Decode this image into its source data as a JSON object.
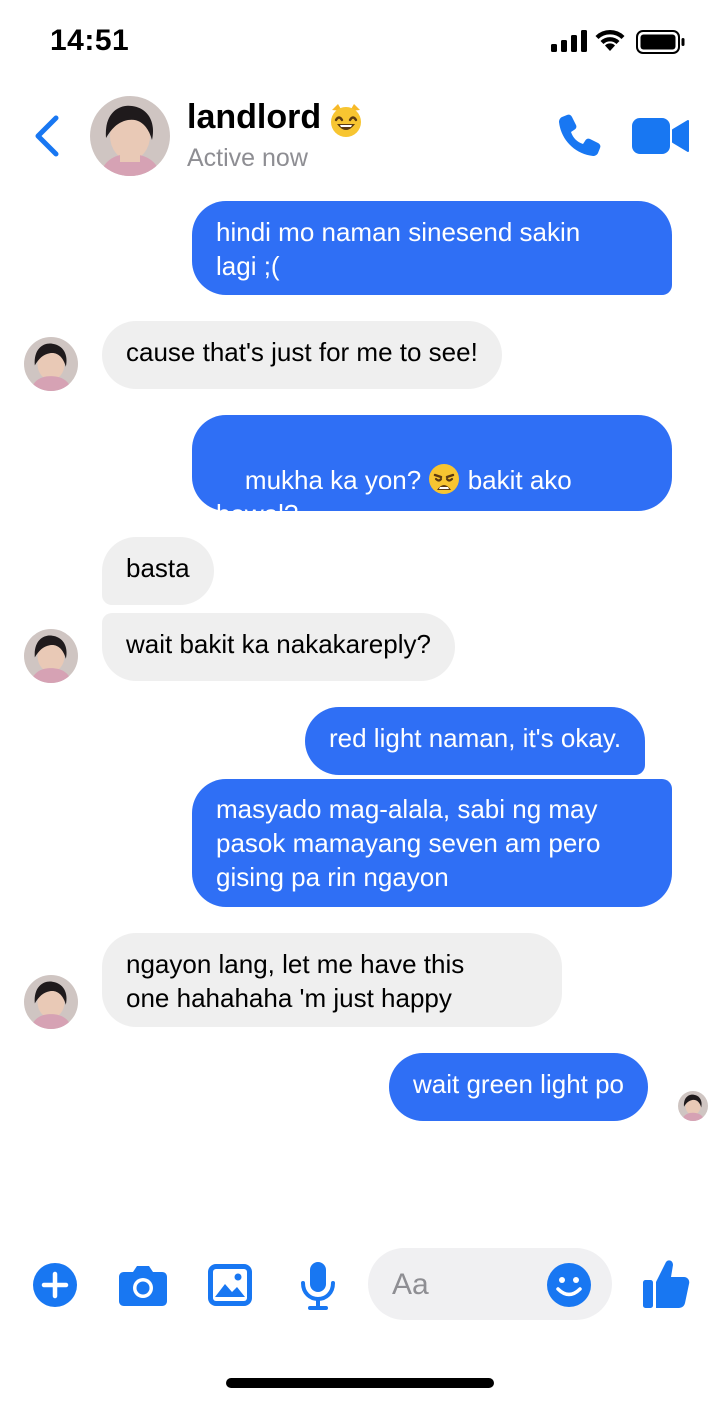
{
  "status_bar": {
    "time": "14:51"
  },
  "header": {
    "contact_name": "landlord",
    "contact_status": "Active now",
    "emoji_icon": "grinning-cat-emoji"
  },
  "messages": [
    {
      "from": "me",
      "text": "hindi mo naman sinesend sakin\nlagi ;("
    },
    {
      "from": "them",
      "text": "cause that's just for me to see!"
    },
    {
      "from": "me",
      "text_a": "mukha ka yon? ",
      "emoji": "weary-face",
      "text_b": " bakit ako\nbawal?"
    },
    {
      "from": "them",
      "text": "basta"
    },
    {
      "from": "them",
      "text": "wait bakit ka nakakareply?"
    },
    {
      "from": "me",
      "text": "red light naman, it's okay."
    },
    {
      "from": "me",
      "text": "masyado mag-alala, sabi ng may\npasok mamayang seven am pero\ngising pa rin ngayon"
    },
    {
      "from": "them",
      "text": "ngayon lang, let me have this\none hahahaha 'm just happy"
    },
    {
      "from": "me",
      "text": "wait green light po"
    }
  ],
  "composer": {
    "placeholder": "Aa"
  },
  "colors": {
    "accent": "#1877f2",
    "outgoing_bubble": "#2f6ff5",
    "incoming_bubble": "#efefef"
  }
}
